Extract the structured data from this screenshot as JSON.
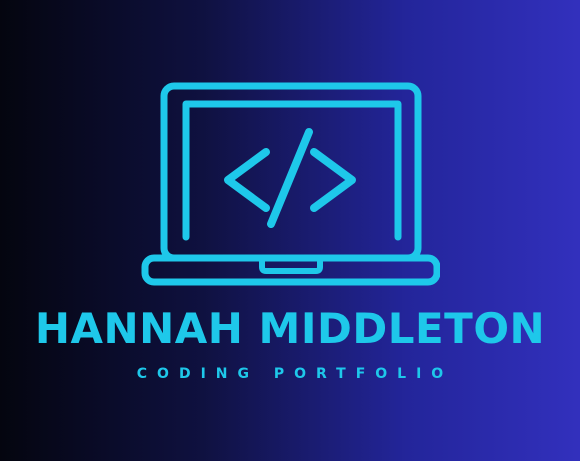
{
  "brand": {
    "name": "HANNAH MIDDLETON",
    "tagline": "CODING PORTFOLIO"
  },
  "logo": {
    "icon": "laptop-code-icon"
  },
  "colors": {
    "accent": "#1ec8ea",
    "background_start": "#04050f",
    "background_end": "#3230bd"
  }
}
